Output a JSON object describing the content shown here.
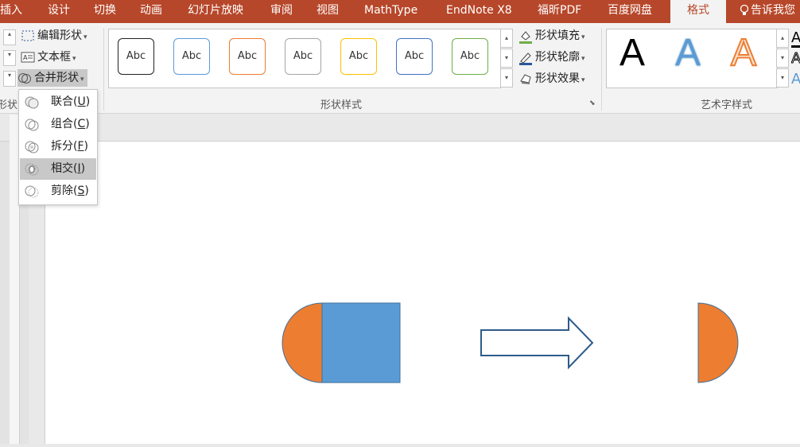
{
  "tabs": [
    "插入",
    "设计",
    "切换",
    "动画",
    "幻灯片放映",
    "审阅",
    "视图",
    "MathType",
    "EndNote X8",
    "福昕PDF",
    "百度网盘",
    "格式",
    "告诉我您"
  ],
  "active_tab": "格式",
  "insert_shapes": {
    "edit_shape": "编辑形状",
    "text_box": "文本框",
    "merge_shapes": "合并形状",
    "group_label_partial": "形状"
  },
  "shape_styles": {
    "swatch_text": "Abc",
    "swatch_colors": [
      "#222222",
      "#5b9bd5",
      "#ed7d31",
      "#a5a5a5",
      "#ffc000",
      "#4472c4",
      "#70ad47"
    ],
    "shape_fill": "形状填充",
    "shape_outline": "形状轮廓",
    "shape_effects": "形状效果",
    "group_label": "形状样式"
  },
  "wordart": {
    "letter": "A",
    "styles": [
      "#000000",
      "#5b9bd5",
      "#ed7d31"
    ],
    "group_label": "艺术字样式"
  },
  "merge_menu": {
    "items": [
      {
        "label": "联合",
        "key": "U"
      },
      {
        "label": "组合",
        "key": "C"
      },
      {
        "label": "拆分",
        "key": "F"
      },
      {
        "label": "相交",
        "key": "I"
      },
      {
        "label": "剪除",
        "key": "S"
      }
    ],
    "highlighted": "相交"
  },
  "slide": {
    "colors": {
      "orange": "#ed7d31",
      "blue": "#5b9bd5",
      "outline": "#41719c",
      "arrow_stroke": "#2e5c8a"
    }
  }
}
